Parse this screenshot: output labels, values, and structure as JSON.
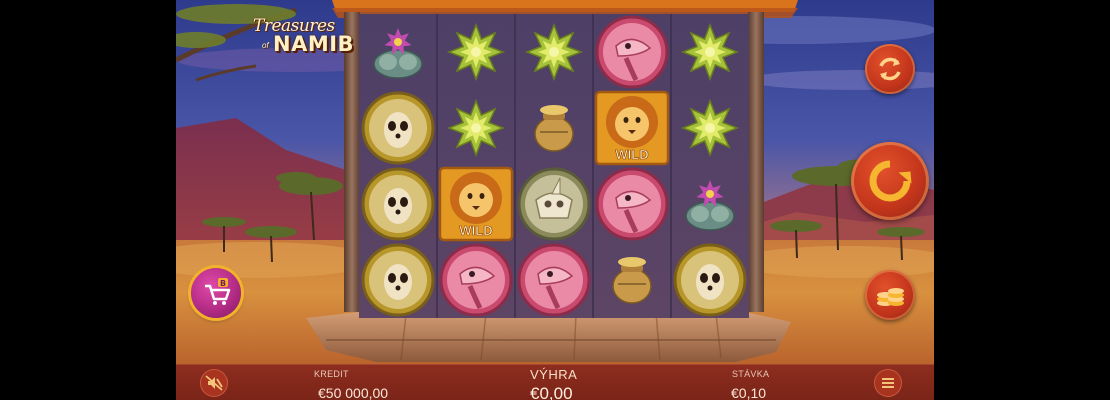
{
  "game": {
    "logo_line1": "Treasures",
    "logo_line2": "of",
    "logo_line3": "NAMIB"
  },
  "reels": {
    "wild_label": "WILD",
    "grid": [
      [
        "flower-cactus",
        "meerkat",
        "meerkat",
        "meerkat"
      ],
      [
        "star-succulent",
        "star-succulent",
        "lion-wild",
        "ostrich"
      ],
      [
        "star-succulent",
        "clay-pot",
        "rhino-skull",
        "ostrich"
      ],
      [
        "ostrich",
        "lion-wild",
        "ostrich",
        "clay-pot"
      ],
      [
        "star-succulent",
        "star-succulent",
        "flower-cactus",
        "meerkat"
      ]
    ]
  },
  "controls": {
    "autoplay_icon": "autoplay-arrows-icon",
    "spin_icon": "spin-arrow-icon",
    "bet_icon": "coins-stack-icon",
    "buy_icon": "bonus-cart-icon",
    "sound_icon": "sound-muted-icon",
    "menu_icon": "menu-icon"
  },
  "bottom_bar": {
    "credit_label": "KREDIT",
    "credit_value": "€50 000,00",
    "win_label": "VÝHRA",
    "win_value": "€0,00",
    "bet_label": "STÁVKA",
    "bet_value": "€0,10"
  },
  "colors": {
    "button_red": "#c4361c",
    "bar_bg": "#8d2d1f",
    "wild_gold": "#f3b52a",
    "frame_wood": "#7a5a48"
  }
}
